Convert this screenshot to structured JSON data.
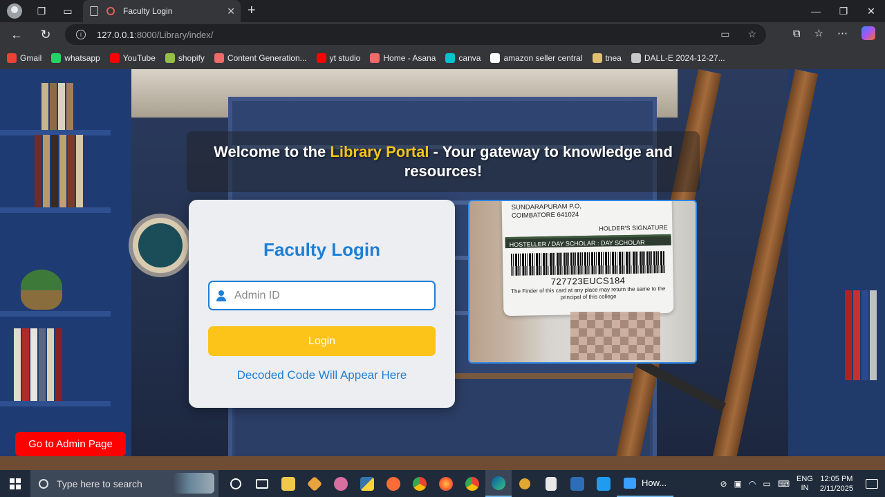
{
  "browser": {
    "tab_title": "Faculty Login",
    "url_host": "127.0.0.1",
    "url_path": ":8000/Library/index/",
    "bookmarks": [
      {
        "label": "Gmail",
        "icon": "gmail-icon",
        "color": "#ea4335"
      },
      {
        "label": "whatsapp",
        "icon": "whatsapp-icon",
        "color": "#25d366"
      },
      {
        "label": "YouTube",
        "icon": "youtube-icon",
        "color": "#ff0000"
      },
      {
        "label": "shopify",
        "icon": "shopify-icon",
        "color": "#95bf47"
      },
      {
        "label": "Content Generation...",
        "icon": "asana-icon",
        "color": "#f06a6a"
      },
      {
        "label": "yt studio",
        "icon": "youtube-icon",
        "color": "#ff0000"
      },
      {
        "label": "Home - Asana",
        "icon": "asana-icon",
        "color": "#f06a6a"
      },
      {
        "label": "canva",
        "icon": "canva-icon",
        "color": "#00c4cc"
      },
      {
        "label": "amazon seller central",
        "icon": "amazon-icon",
        "color": "#ffffff"
      },
      {
        "label": "tnea",
        "icon": "tnea-icon",
        "color": "#e0c070"
      },
      {
        "label": "DALL-E 2024-12-27...",
        "icon": "file-icon",
        "color": "#c8c8c8"
      }
    ]
  },
  "page": {
    "banner": {
      "prefix": "Welcome to the ",
      "accent": "Library Portal",
      "suffix": " - Your gateway to knowledge and resources!"
    },
    "login": {
      "title": "Faculty Login",
      "admin_id_placeholder": "Admin ID",
      "admin_id_value": "",
      "login_label": "Login",
      "decoded_text": "Decoded Code Will Appear Here"
    },
    "camera": {
      "card_address_line1": "SUNDARAPURAM P.O,",
      "card_address_line2": "COIMBATORE 641024",
      "card_signature": "HOLDER'S SIGNATURE",
      "card_type": "HOSTELLER / DAY SCHOLAR :  DAY SCHOLAR",
      "barcode_number": "727723EUCS184",
      "card_footer": "The Finder of this card at any place may return the same to the principal of this college"
    },
    "admin_button_label": "Go to Admin Page"
  },
  "taskbar": {
    "search_placeholder": "Type here to search",
    "how_label": "How...",
    "lang_line1": "ENG",
    "lang_line2": "IN",
    "time": "12:05 PM",
    "date": "2/11/2025"
  },
  "colors": {
    "accent_blue": "#1e7fd6",
    "login_yellow": "#fcc419",
    "banner_gold": "#f5c518",
    "admin_red": "#ff0000"
  }
}
